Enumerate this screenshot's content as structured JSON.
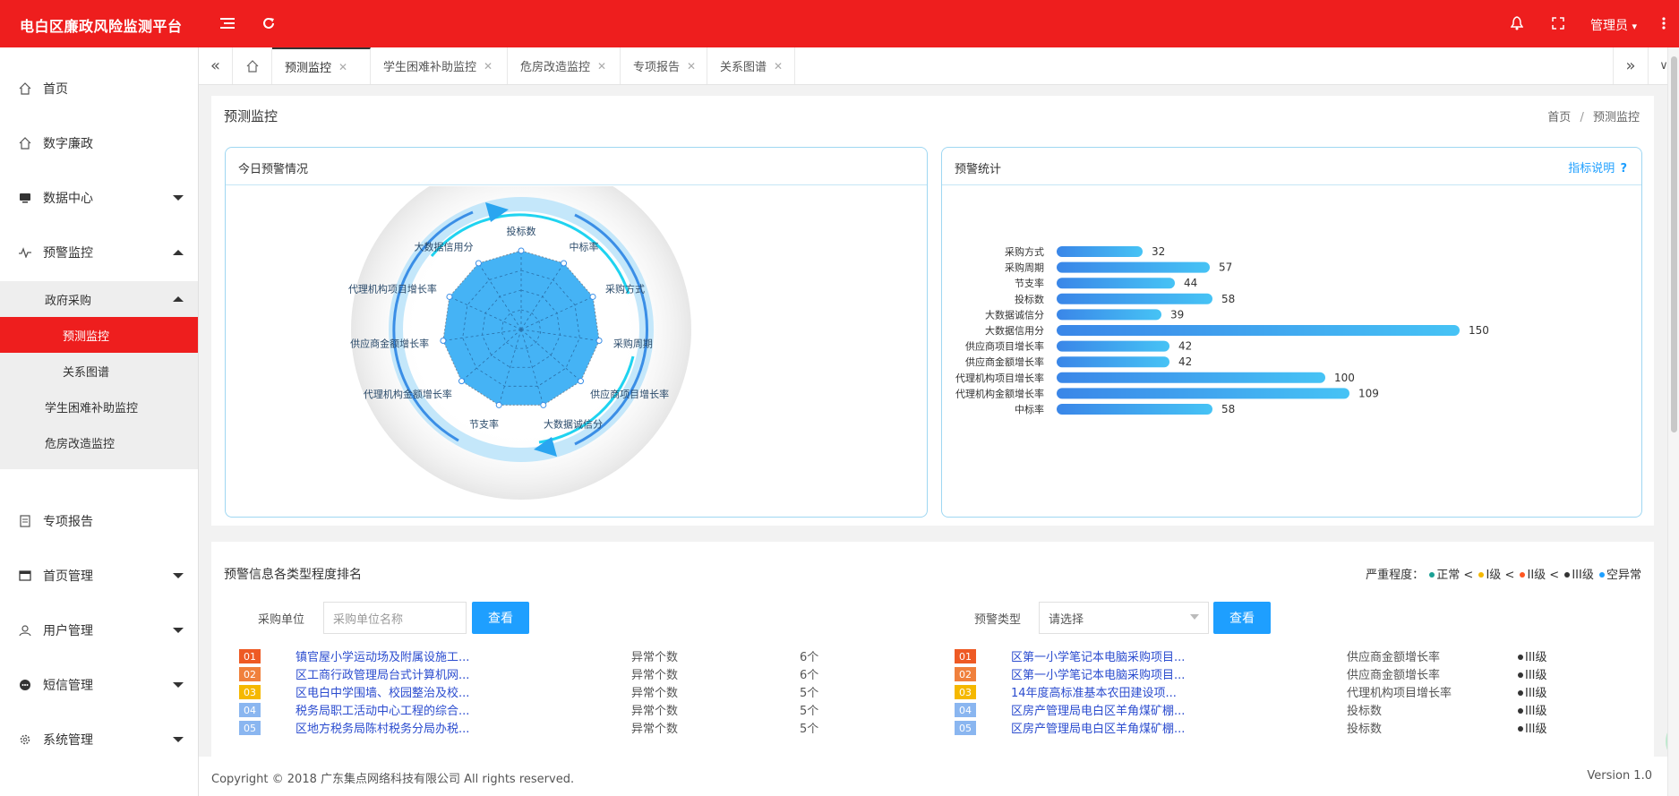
{
  "topbar": {
    "brand": "电白区廉政风险监测平台",
    "user": "管理员"
  },
  "sidebar": {
    "items": [
      {
        "label": "首页",
        "icon": "home-icon"
      },
      {
        "label": "数字廉政",
        "icon": "home-icon"
      },
      {
        "label": "数据中心",
        "icon": "database-icon"
      },
      {
        "label": "预警监控",
        "icon": "pulse-icon"
      },
      {
        "label": "专项报告",
        "icon": "report-icon"
      },
      {
        "label": "首页管理",
        "icon": "card-icon"
      },
      {
        "label": "用户管理",
        "icon": "user-icon"
      },
      {
        "label": "短信管理",
        "icon": "message-icon"
      },
      {
        "label": "系统管理",
        "icon": "gear-icon"
      }
    ],
    "sub": [
      {
        "label": "政府采购"
      },
      {
        "label": "预测监控"
      },
      {
        "label": "关系图谱"
      },
      {
        "label": "学生困难补助监控"
      },
      {
        "label": "危房改造监控"
      }
    ]
  },
  "tabs": [
    "预测监控",
    "学生困难补助监控",
    "危房改造监控",
    "专项报告",
    "关系图谱"
  ],
  "page": {
    "title": "预测监控",
    "breadcrumb_home": "首页",
    "breadcrumb_sep": "/",
    "breadcrumb_current": "预测监控"
  },
  "radar_panel": {
    "title": "今日预警情况"
  },
  "bar_panel": {
    "title": "预警统计",
    "help": "指标说明"
  },
  "chart_data": [
    {
      "type": "radar",
      "categories": [
        "投标数",
        "中标率",
        "采购方式",
        "采购周期",
        "供应商项目增长率",
        "大数据诚信分",
        "节支率",
        "代理机构金额增长率",
        "供应商金额增长率",
        "代理机构项目增长率",
        "大数据信用分"
      ],
      "fill_color": "#45b3f5"
    },
    {
      "type": "bar",
      "orientation": "horizontal",
      "categories": [
        "采购方式",
        "采购周期",
        "节支率",
        "投标数",
        "大数据诚信分",
        "大数据信用分",
        "供应商项目增长率",
        "供应商金额增长率",
        "代理机构项目增长率",
        "代理机构金额增长率",
        "中标率"
      ],
      "values": [
        32,
        57,
        44,
        58,
        39,
        150,
        42,
        42,
        100,
        109,
        58
      ],
      "xlim": [
        0,
        150
      ],
      "colors": [
        "#3a86e8",
        "#46c3f5"
      ]
    }
  ],
  "ranking": {
    "title": "预警信息各类型程度排名",
    "severity_label": "严重程度：",
    "severity": [
      {
        "label": "正常",
        "color": "#1aa094"
      },
      {
        "label": "I级",
        "color": "#f5b800"
      },
      {
        "label": "II级",
        "color": "#ff5722"
      },
      {
        "label": "III级",
        "color": "#333333"
      },
      {
        "label": "空异常",
        "color": "#1e9fff"
      }
    ],
    "left_filter_label": "采购单位",
    "left_filter_placeholder": "采购单位名称",
    "right_filter_label": "预警类型",
    "right_filter_value": "请选择",
    "search_btn": "查看",
    "left_rows": [
      {
        "rank": "01",
        "name": "镇官屋小学运动场及附属设施工...",
        "type": "异常个数",
        "count": "6个"
      },
      {
        "rank": "02",
        "name": "区工商行政管理局台式计算机网...",
        "type": "异常个数",
        "count": "6个"
      },
      {
        "rank": "03",
        "name": "区电白中学围墙、校园整治及校...",
        "type": "异常个数",
        "count": "5个"
      },
      {
        "rank": "04",
        "name": "税务局职工活动中心工程的综合...",
        "type": "异常个数",
        "count": "5个"
      },
      {
        "rank": "05",
        "name": "区地方税务局陈村税务分局办税...",
        "type": "异常个数",
        "count": "5个"
      }
    ],
    "right_rows": [
      {
        "rank": "01",
        "name": "区第一小学笔记本电脑采购项目...",
        "type": "供应商金额增长率",
        "level": "III级"
      },
      {
        "rank": "02",
        "name": "区第一小学笔记本电脑采购项目...",
        "type": "供应商金额增长率",
        "level": "III级"
      },
      {
        "rank": "03",
        "name": "14年度高标准基本农田建设项...",
        "type": "代理机构项目增长率",
        "level": "III级"
      },
      {
        "rank": "04",
        "name": "区房产管理局电白区羊角煤矿棚...",
        "type": "投标数",
        "level": "III级"
      },
      {
        "rank": "05",
        "name": "区房产管理局电白区羊角煤矿棚...",
        "type": "投标数",
        "level": "III级"
      }
    ],
    "rank_colors": [
      "#ee5a24",
      "#f0803c",
      "#f5b800",
      "#8ab6f0",
      "#8ab6f0"
    ]
  },
  "footer": {
    "copyright": "Copyright © 2018 广东集点网络科技有限公司 All rights reserved.",
    "version": "Version 1.0"
  }
}
